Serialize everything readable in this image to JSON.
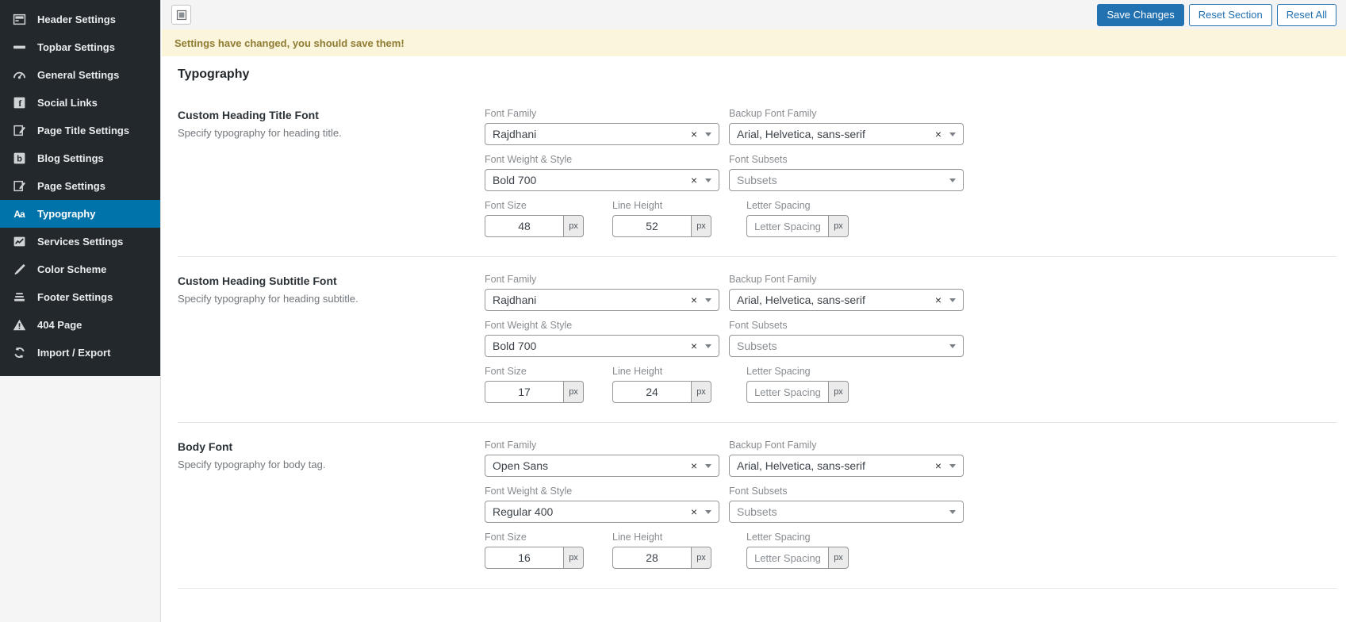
{
  "colors": {
    "accent": "#0073aa",
    "primary_button": "#2271b1",
    "sidebar_bg": "#23282d",
    "notice_bg": "#fbf5dc",
    "notice_text": "#8f7c33",
    "divider": "#e3e5e8"
  },
  "sidebar": {
    "items": [
      {
        "label": "Header Settings",
        "icon": "header-icon"
      },
      {
        "label": "Topbar Settings",
        "icon": "topbar-icon"
      },
      {
        "label": "General Settings",
        "icon": "dashboard-icon"
      },
      {
        "label": "Social Links",
        "icon": "facebook-icon"
      },
      {
        "label": "Page Title Settings",
        "icon": "edit-icon"
      },
      {
        "label": "Blog Settings",
        "icon": "blog-icon"
      },
      {
        "label": "Page Settings",
        "icon": "edit-icon"
      },
      {
        "label": "Typography",
        "icon": "typography-icon",
        "active": true
      },
      {
        "label": "Services Settings",
        "icon": "chart-icon"
      },
      {
        "label": "Color Scheme",
        "icon": "brush-icon"
      },
      {
        "label": "Footer Settings",
        "icon": "footer-icon"
      },
      {
        "label": "404 Page",
        "icon": "warning-icon"
      },
      {
        "label": "Import / Export",
        "icon": "sync-icon"
      }
    ]
  },
  "toolbar": {
    "save_label": "Save Changes",
    "reset_section_label": "Reset Section",
    "reset_all_label": "Reset All"
  },
  "notice": {
    "message": "Settings have changed, you should save them!"
  },
  "page": {
    "title": "Typography"
  },
  "labels": {
    "font_family": "Font Family",
    "backup_font_family": "Backup Font Family",
    "font_weight_style": "Font Weight & Style",
    "font_subsets": "Font Subsets",
    "font_size": "Font Size",
    "line_height": "Line Height",
    "letter_spacing": "Letter Spacing",
    "unit": "px"
  },
  "placeholders": {
    "subsets": "Subsets",
    "letter_spacing": "Letter Spacing"
  },
  "sections": [
    {
      "title": "Custom Heading Title Font",
      "description": "Specify typography for heading title.",
      "font_family": "Rajdhani",
      "backup_font_family": "Arial, Helvetica, sans-serif",
      "font_weight_style": "Bold 700",
      "font_size": "48",
      "line_height": "52"
    },
    {
      "title": "Custom Heading Subtitle Font",
      "description": "Specify typography for heading subtitle.",
      "font_family": "Rajdhani",
      "backup_font_family": "Arial, Helvetica, sans-serif",
      "font_weight_style": "Bold 700",
      "font_size": "17",
      "line_height": "24"
    },
    {
      "title": "Body Font",
      "description": "Specify typography for body tag.",
      "font_family": "Open Sans",
      "backup_font_family": "Arial, Helvetica, sans-serif",
      "font_weight_style": "Regular 400",
      "font_size": "16",
      "line_height": "28"
    }
  ]
}
